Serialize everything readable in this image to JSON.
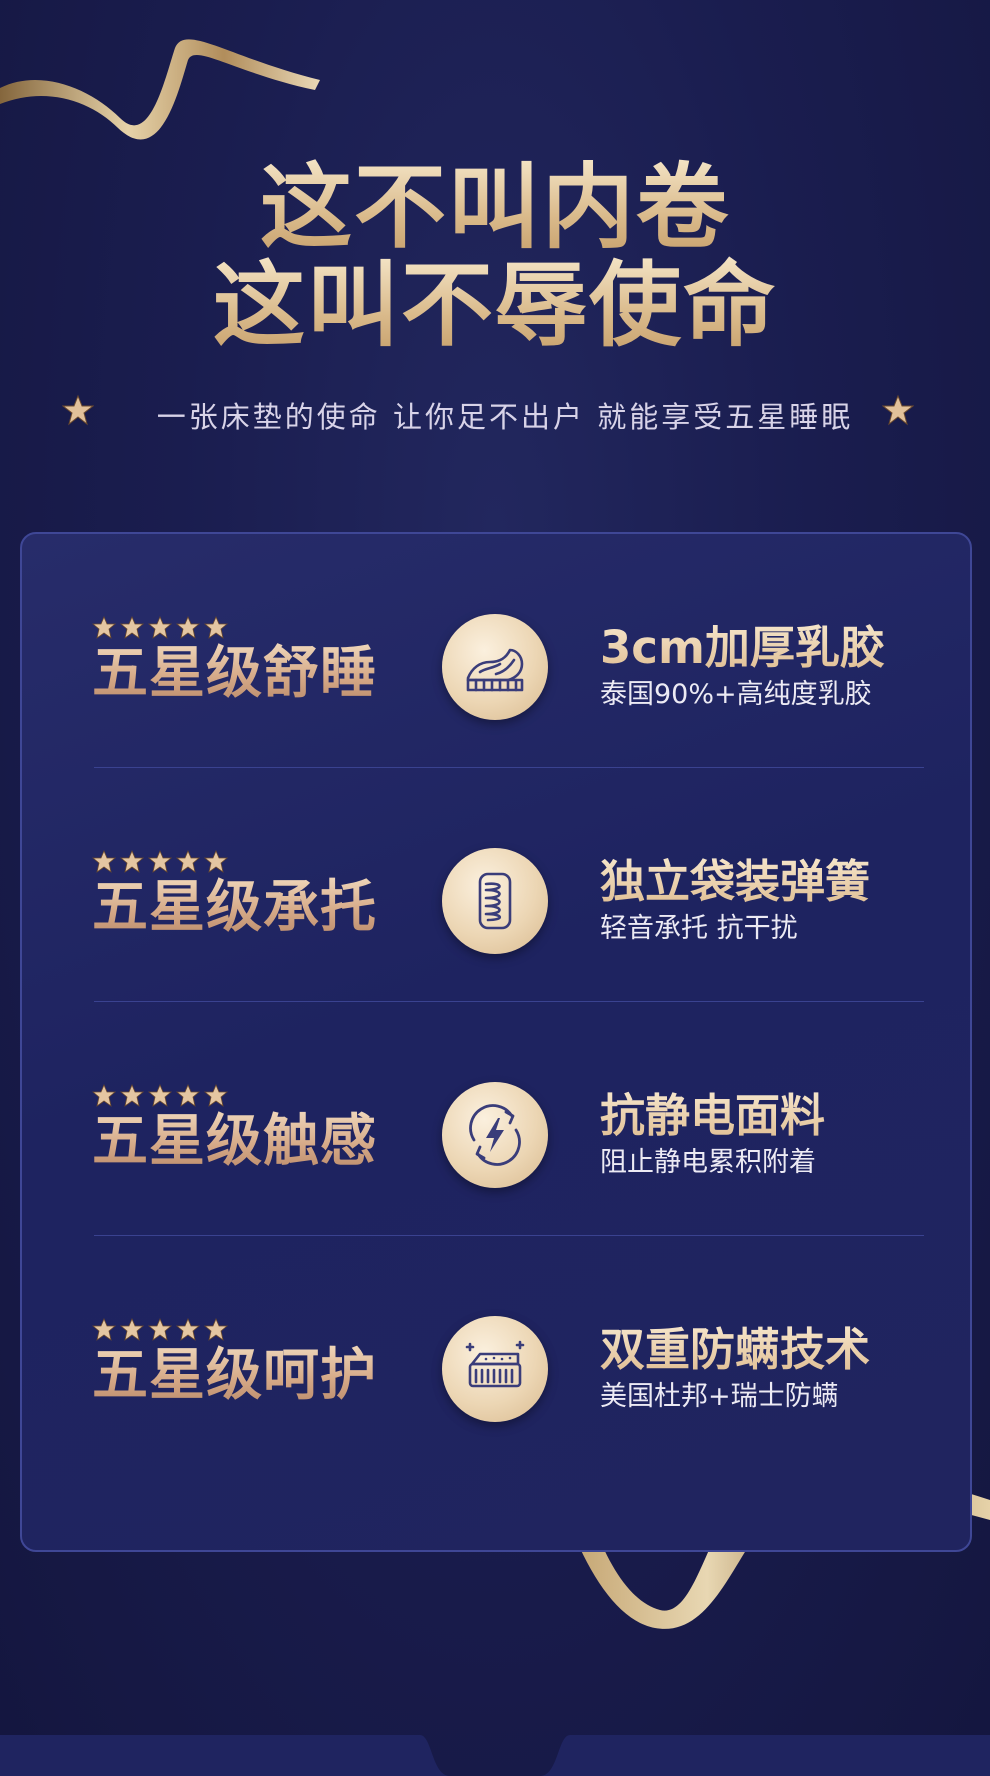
{
  "header": {
    "headline_line1": "这不叫内卷",
    "headline_line2": "这叫不辱使命",
    "tagline": "一张床垫的使命 让你足不出户 就能享受五星睡眠"
  },
  "features": [
    {
      "rating_stars": 5,
      "title": "五星级舒睡",
      "icon": "latex-foam-icon",
      "feature_title": "3cm加厚乳胶",
      "feature_sub": "泰国90%+高纯度乳胶"
    },
    {
      "rating_stars": 5,
      "title": "五星级承托",
      "icon": "pocket-spring-icon",
      "feature_title": "独立袋装弹簧",
      "feature_sub": "轻音承托 抗干扰"
    },
    {
      "rating_stars": 5,
      "title": "五星级触感",
      "icon": "antistatic-icon",
      "feature_title": "抗静电面料",
      "feature_sub": "阻止静电累积附着"
    },
    {
      "rating_stars": 5,
      "title": "五星级呵护",
      "icon": "anti-mite-mattress-icon",
      "feature_title": "双重防螨技术",
      "feature_sub": "美国杜邦+瑞士防螨"
    }
  ],
  "colors": {
    "background": "#1a1d4f",
    "panel": "#20245f",
    "panel_border": "#3f4796",
    "gold": "#dfbd92",
    "rose_gold": "#d5a987",
    "text_light": "#eceaf4"
  }
}
